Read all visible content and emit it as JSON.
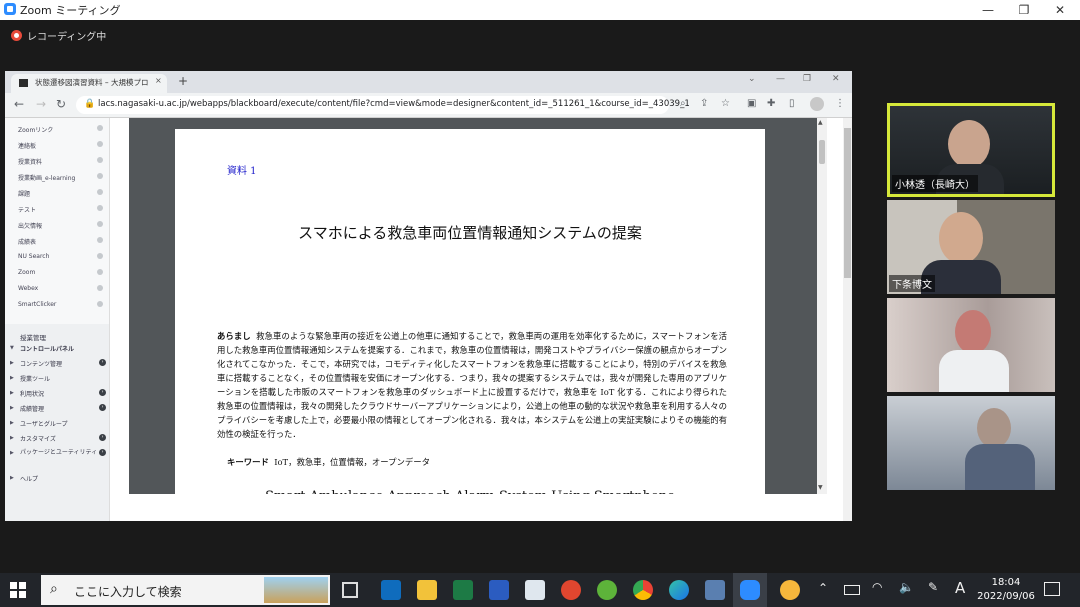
{
  "zoom": {
    "window_title": "Zoom ミーティング",
    "recording": "レコーディング中",
    "window_controls": {
      "minimize": "—",
      "restore": "❐",
      "close": "✕"
    }
  },
  "browser": {
    "tab_title": "状態遷移図演習資料 – 大規模プロ",
    "tab_close": "×",
    "new_tab": "+",
    "url": "lacs.nagasaki-u.ac.jp/webapps/blackboard/execute/content/file?cmd=view&mode=designer&content_id=_511261_1&course_id=_43039_1"
  },
  "lms_menu": {
    "items": [
      "Zoomリンク",
      "連絡板",
      "授業資料",
      "授業動画_e-learning",
      "課題",
      "テスト",
      "出欠情報",
      "成績表",
      "NU Search",
      "Zoom",
      "Webex",
      "SmartClicker"
    ],
    "management_title": "授業管理",
    "control_panel": "コントロールパネル",
    "panel_items": [
      "コンテンツ管理",
      "授業ツール",
      "利用状況",
      "成績管理",
      "ユーザとグループ",
      "カスタマイズ",
      "パッケージとユーティリティ",
      "ヘルプ"
    ]
  },
  "document": {
    "label": "資料 1",
    "title": "スマホによる救急車両位置情報通知システムの提案",
    "abstract_heading": "あらまし",
    "abstract": "救急車のような緊急車両の接近を公道上の他車に通知することで，救急車両の運用を効率化するために，スマートフォンを活用した救急車両位置情報通知システムを提案する．これまで，救急車の位置情報は，開発コストやプライバシー保護の観点からオープン化されてこなかった．そこで，本研究では，コモディティ化したスマートフォンを救急車に搭載することにより，特別のデバイスを救急車に搭載することなく，その位置情報を安価にオープン化する．つまり，我々の提案するシステムでは，我々が開発した専用のアプリケーションを搭載した市販のスマートフォンを救急車のダッシュボード上に設置するだけで，救急車を IoT 化する．これにより得られた救急車の位置情報は，我々の開発したクラウドサーバーアプリケーションにより，公道上の他車の動的な状況や救急車を利用する人々のプライバシーを考慮した上で，必要最小限の情報としてオープン化される．我々は，本システムを公道上の実証実験によりその機能的有効性の検証を行った．",
    "keyword_heading": "キーワード",
    "keywords": "IoT，救急車，位置情報，オープンデータ",
    "english_title": "Smart Ambulance Approach Alarm System Using Smartphone"
  },
  "participants": [
    {
      "name": "小林透（長崎大）",
      "active": true
    },
    {
      "name": "下条博文",
      "active": false
    },
    {
      "name": "",
      "active": false
    },
    {
      "name": "",
      "active": false
    }
  ],
  "taskbar": {
    "search_placeholder": "ここに入力して検索",
    "time": "18:04",
    "date": "2022/09/06",
    "ime": "A"
  },
  "colors": {
    "active_speaker_border": "#d6e83a",
    "zoom_blue": "#2d8cff",
    "recording_red": "#e84a3a"
  }
}
